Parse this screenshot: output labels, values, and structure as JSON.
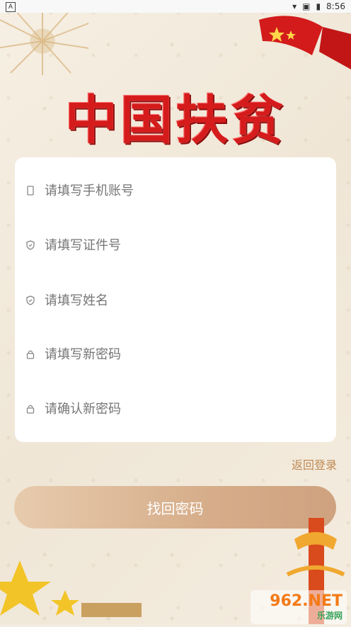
{
  "status_bar": {
    "left_icon": "A",
    "time": "8:56"
  },
  "title": "中国扶贫",
  "form": {
    "fields": [
      {
        "icon": "phone-icon",
        "placeholder": "请填写手机账号"
      },
      {
        "icon": "shield-icon",
        "placeholder": "请填写证件号"
      },
      {
        "icon": "shield-icon",
        "placeholder": "请填写姓名"
      },
      {
        "icon": "lock-icon",
        "placeholder": "请填写新密码"
      },
      {
        "icon": "lock-icon",
        "placeholder": "请确认新密码"
      }
    ]
  },
  "back_login_label": "返回登录",
  "submit_label": "找回密码",
  "watermark": {
    "top": "962.NET",
    "bottom": "乐游网"
  },
  "colors": {
    "title_red": "#d51b1b",
    "link_color": "#c08a54",
    "button_gradient_start": "#e7cbad",
    "button_gradient_end": "#cfa27f"
  }
}
